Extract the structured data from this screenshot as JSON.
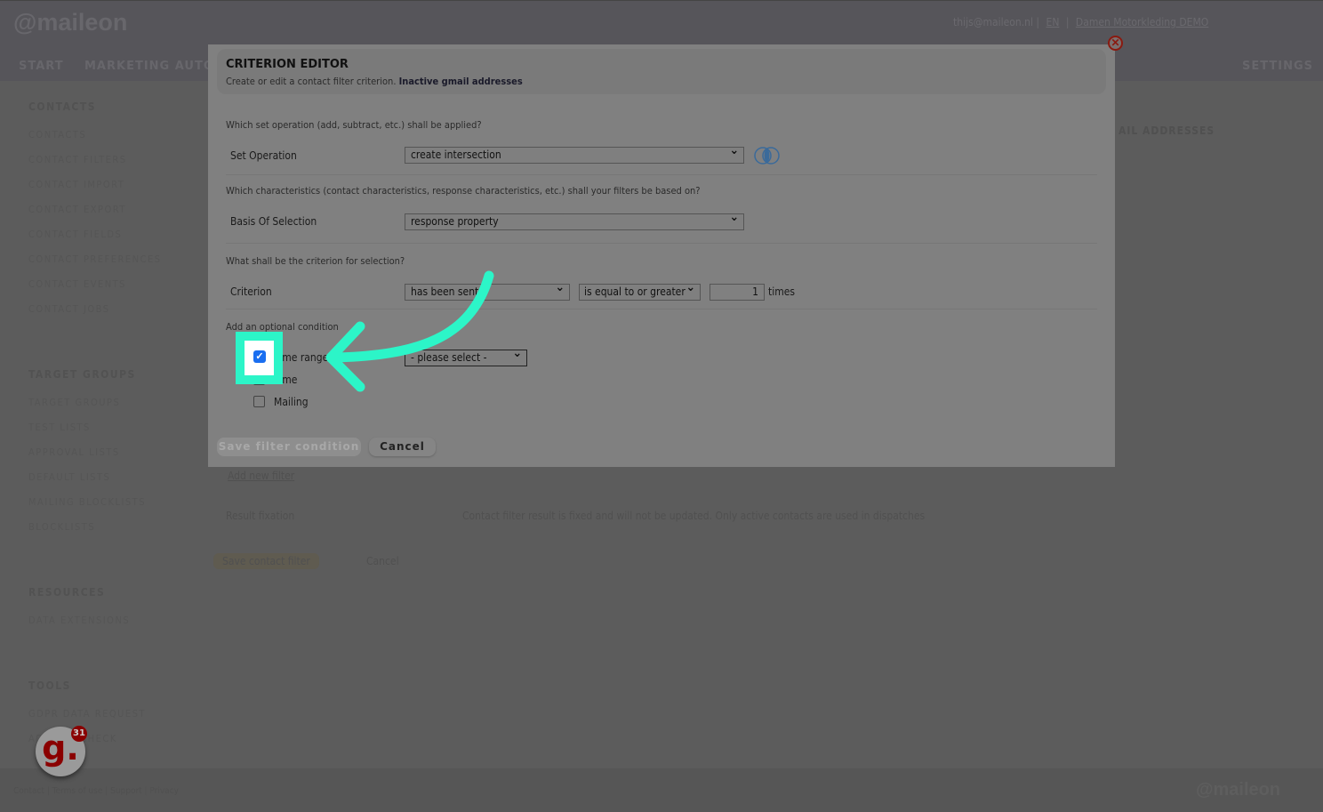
{
  "header": {
    "logo": "@maileon",
    "user": "thijs@maileon.nl",
    "lang": "EN",
    "account": "Damen Motorkleding DEMO",
    "nav": [
      "START",
      "MARKETING AUTO",
      "SETTINGS"
    ]
  },
  "sidebar": {
    "sections": [
      {
        "title": "CONTACTS",
        "items": [
          "CONTACTS",
          "CONTACT FILTERS",
          "CONTACT IMPORT",
          "CONTACT EXPORT",
          "CONTACT FIELDS",
          "CONTACT PREFERENCES",
          "CONTACT EVENTS",
          "CONTACT JOBS"
        ]
      },
      {
        "title": "TARGET GROUPS",
        "items": [
          "TARGET GROUPS",
          "TEST LISTS",
          "APPROVAL LISTS",
          "DEFAULT LISTS",
          "MAILING BLOCKLISTS",
          "BLOCKLISTS"
        ]
      },
      {
        "title": "RESOURCES",
        "items": [
          "DATA EXTENSIONS"
        ]
      },
      {
        "title": "TOOLS",
        "items": [
          "GDPR DATA REQUEST",
          "ADDRESSCHECK"
        ]
      }
    ]
  },
  "background": {
    "page_title_fragment": "AIL ADDRESSES",
    "add_filter": "Add new filter",
    "result_fixation": "Result fixation",
    "fixation_text": "Contact filter result is fixed and will not be updated. Only active contacts are used in dispatches",
    "save_contact_filter": "Save contact filter",
    "cancel": "Cancel"
  },
  "modal": {
    "title": "CRITERION EDITOR",
    "subtitle": "Create or edit a contact filter criterion.",
    "filter_name": "Inactive gmail addresses",
    "q1": "Which set operation (add, subtract, etc.) shall be applied?",
    "set_operation_label": "Set Operation",
    "set_operation_value": "create intersection",
    "q2": "Which characteristics (contact characteristics, response characteristics, etc.) shall your filters be based on?",
    "basis_label": "Basis Of Selection",
    "basis_value": "response property",
    "q3": "What shall be the criterion for selection?",
    "criterion_label": "Criterion",
    "criterion_value": "has been sent",
    "comparison_value": "is equal to or greater",
    "count_value": "1",
    "times": "times",
    "q4": "Add an optional condition",
    "time_range_label": "Time range",
    "time_range_checked": true,
    "time_range_select": "- please select -",
    "time_label": "Time",
    "time_checked": false,
    "mailing_label": "Mailing",
    "mailing_checked": false,
    "save": "Save filter condition",
    "cancel": "Cancel"
  },
  "footer": {
    "links": "Contact | Terms of use | Support | Privacy",
    "logo": "@maileon"
  },
  "notification_badge": {
    "count": "31",
    "letter": "g."
  },
  "colors": {
    "highlight": "#2cf5c8",
    "close": "#8a1a10",
    "badge": "#8a0000"
  }
}
